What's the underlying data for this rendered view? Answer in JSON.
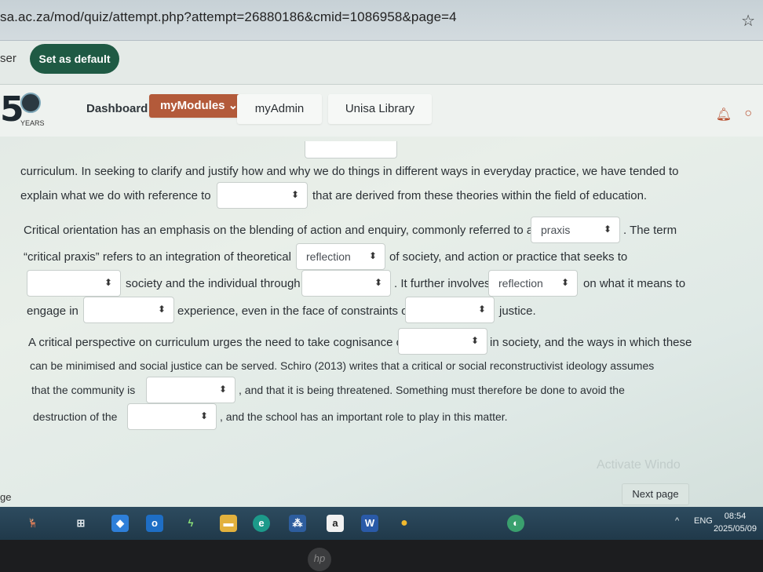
{
  "browser": {
    "url": "sa.ac.za/mod/quiz/attempt.php?attempt=26880186&cmid=1086958&page=4",
    "star_icon": "star-icon",
    "default_prompt_fragment": "ser",
    "set_default_label": "Set as default"
  },
  "site": {
    "logo_number": "5",
    "logo_sub": "YEARS",
    "nav": {
      "dashboard": "Dashboard",
      "mymodules": "myModules ⌄",
      "myadmin": "myAdmin",
      "library": "Unisa Library"
    }
  },
  "question": {
    "p1_l1": "curriculum. In seeking to clarify and justify how and why we do things in different ways in everyday practice, we have tended to",
    "p1_l2a": "explain what we do with reference to",
    "p1_l2b": "that are derived from these theories within the field of education.",
    "p2_l1a": "Critical orientation has an emphasis on the blending of action and enquiry, commonly referred to as",
    "p2_l1b": ". The term",
    "p2_l2a": "“critical praxis” refers to an integration of theoretical",
    "p2_l2b": "of society, and action or practice that seeks to",
    "p2_l3a": "society and the individual through",
    "p2_l3b": ". It further involves",
    "p2_l3c": "on what it means to",
    "p2_l4a": "engage in",
    "p2_l4b": "experience, even in the face of constraints on",
    "p2_l4c": "justice.",
    "p3_l1a": "A critical perspective on curriculum urges the need to take cognisance of",
    "p3_l1b": "in society, and the ways in which these",
    "p3_l2": "can be minimised and social justice can be served. Schiro (2013) writes that a critical or social reconstructivist ideology assumes",
    "p3_l3a": "that the community is",
    "p3_l3b": ", and that it is being threatened. Something must therefore be done to avoid the",
    "p3_l4a": "destruction of the",
    "p3_l4b": ", and the school has an important role to play in this matter."
  },
  "selects": {
    "s_top": "",
    "s1": "",
    "s2": "praxis",
    "s3": "reflection",
    "s4": "",
    "s5": "",
    "s6": "reflection",
    "s7": "",
    "s8": "",
    "s9": "",
    "s10": "",
    "s11": ""
  },
  "footer": {
    "left_fragment": "ge",
    "next_page": "Next page",
    "watermark": "Activate Windo"
  },
  "taskbar": {
    "lang": "ENG",
    "time": "08:54",
    "date": "2025/05/09",
    "chevron": "^"
  },
  "hardware": {
    "brand": "hp"
  }
}
